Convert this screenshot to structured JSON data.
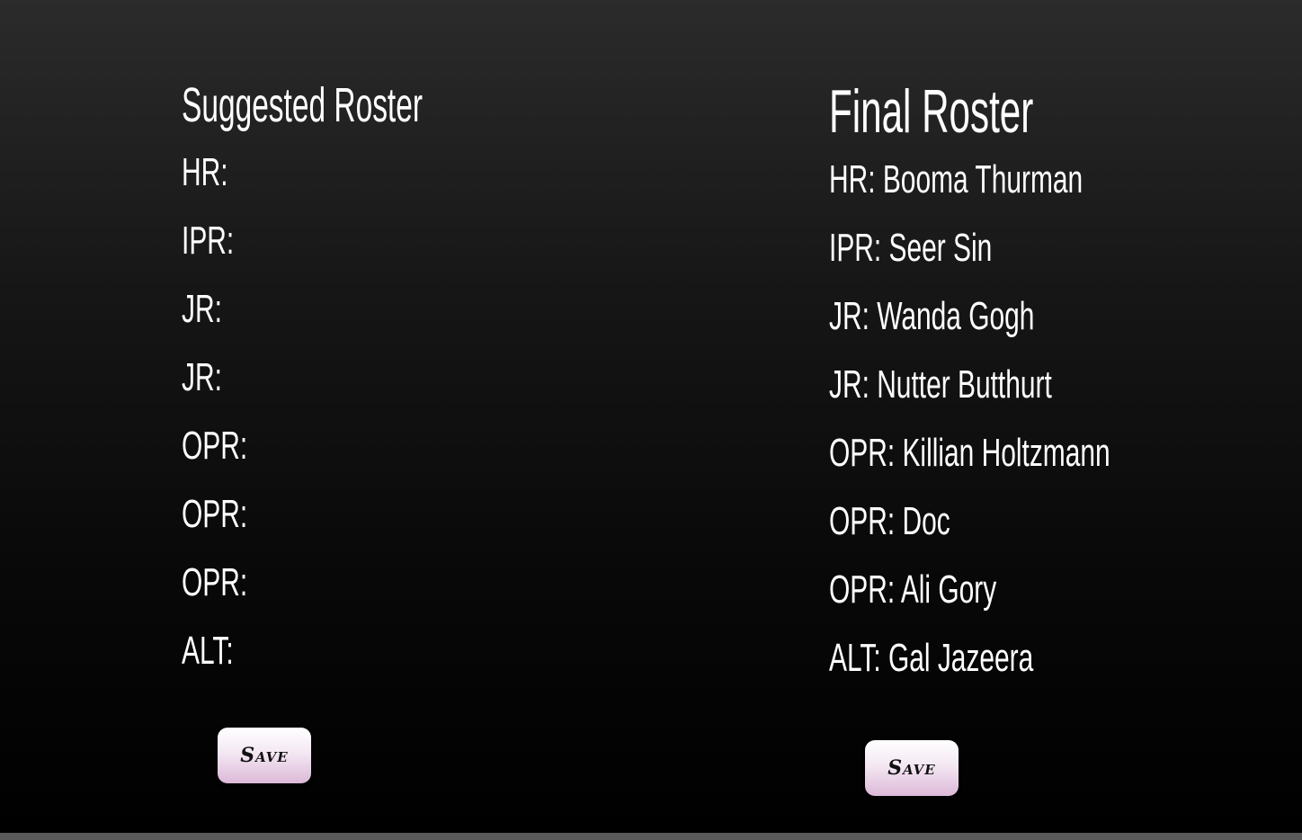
{
  "suggested": {
    "title": "Suggested Roster",
    "rows": [
      {
        "role": "HR:",
        "name": ""
      },
      {
        "role": "IPR:",
        "name": ""
      },
      {
        "role": "JR:",
        "name": ""
      },
      {
        "role": "JR:",
        "name": ""
      },
      {
        "role": "OPR:",
        "name": ""
      },
      {
        "role": "OPR:",
        "name": ""
      },
      {
        "role": "OPR:",
        "name": ""
      },
      {
        "role": "ALT:",
        "name": ""
      }
    ],
    "save_label": "Save"
  },
  "final": {
    "title": "Final Roster",
    "rows": [
      {
        "role": "HR:",
        "name": "Booma Thurman"
      },
      {
        "role": "IPR:",
        "name": "Seer Sin"
      },
      {
        "role": "JR:",
        "name": "Wanda Gogh"
      },
      {
        "role": "JR:",
        "name": "Nutter Butthurt"
      },
      {
        "role": "OPR:",
        "name": "Killian Holtzmann"
      },
      {
        "role": "OPR:",
        "name": "Doc"
      },
      {
        "role": "OPR:",
        "name": "Ali Gory"
      },
      {
        "role": "ALT:",
        "name": "Gal Jazeera"
      }
    ],
    "save_label": "Save"
  },
  "colors": {
    "text": "#ffffff",
    "background_top": "#2b2b2b",
    "background_bottom": "#000000",
    "button_top": "#ffffff",
    "button_bottom": "#dcb9d8"
  }
}
